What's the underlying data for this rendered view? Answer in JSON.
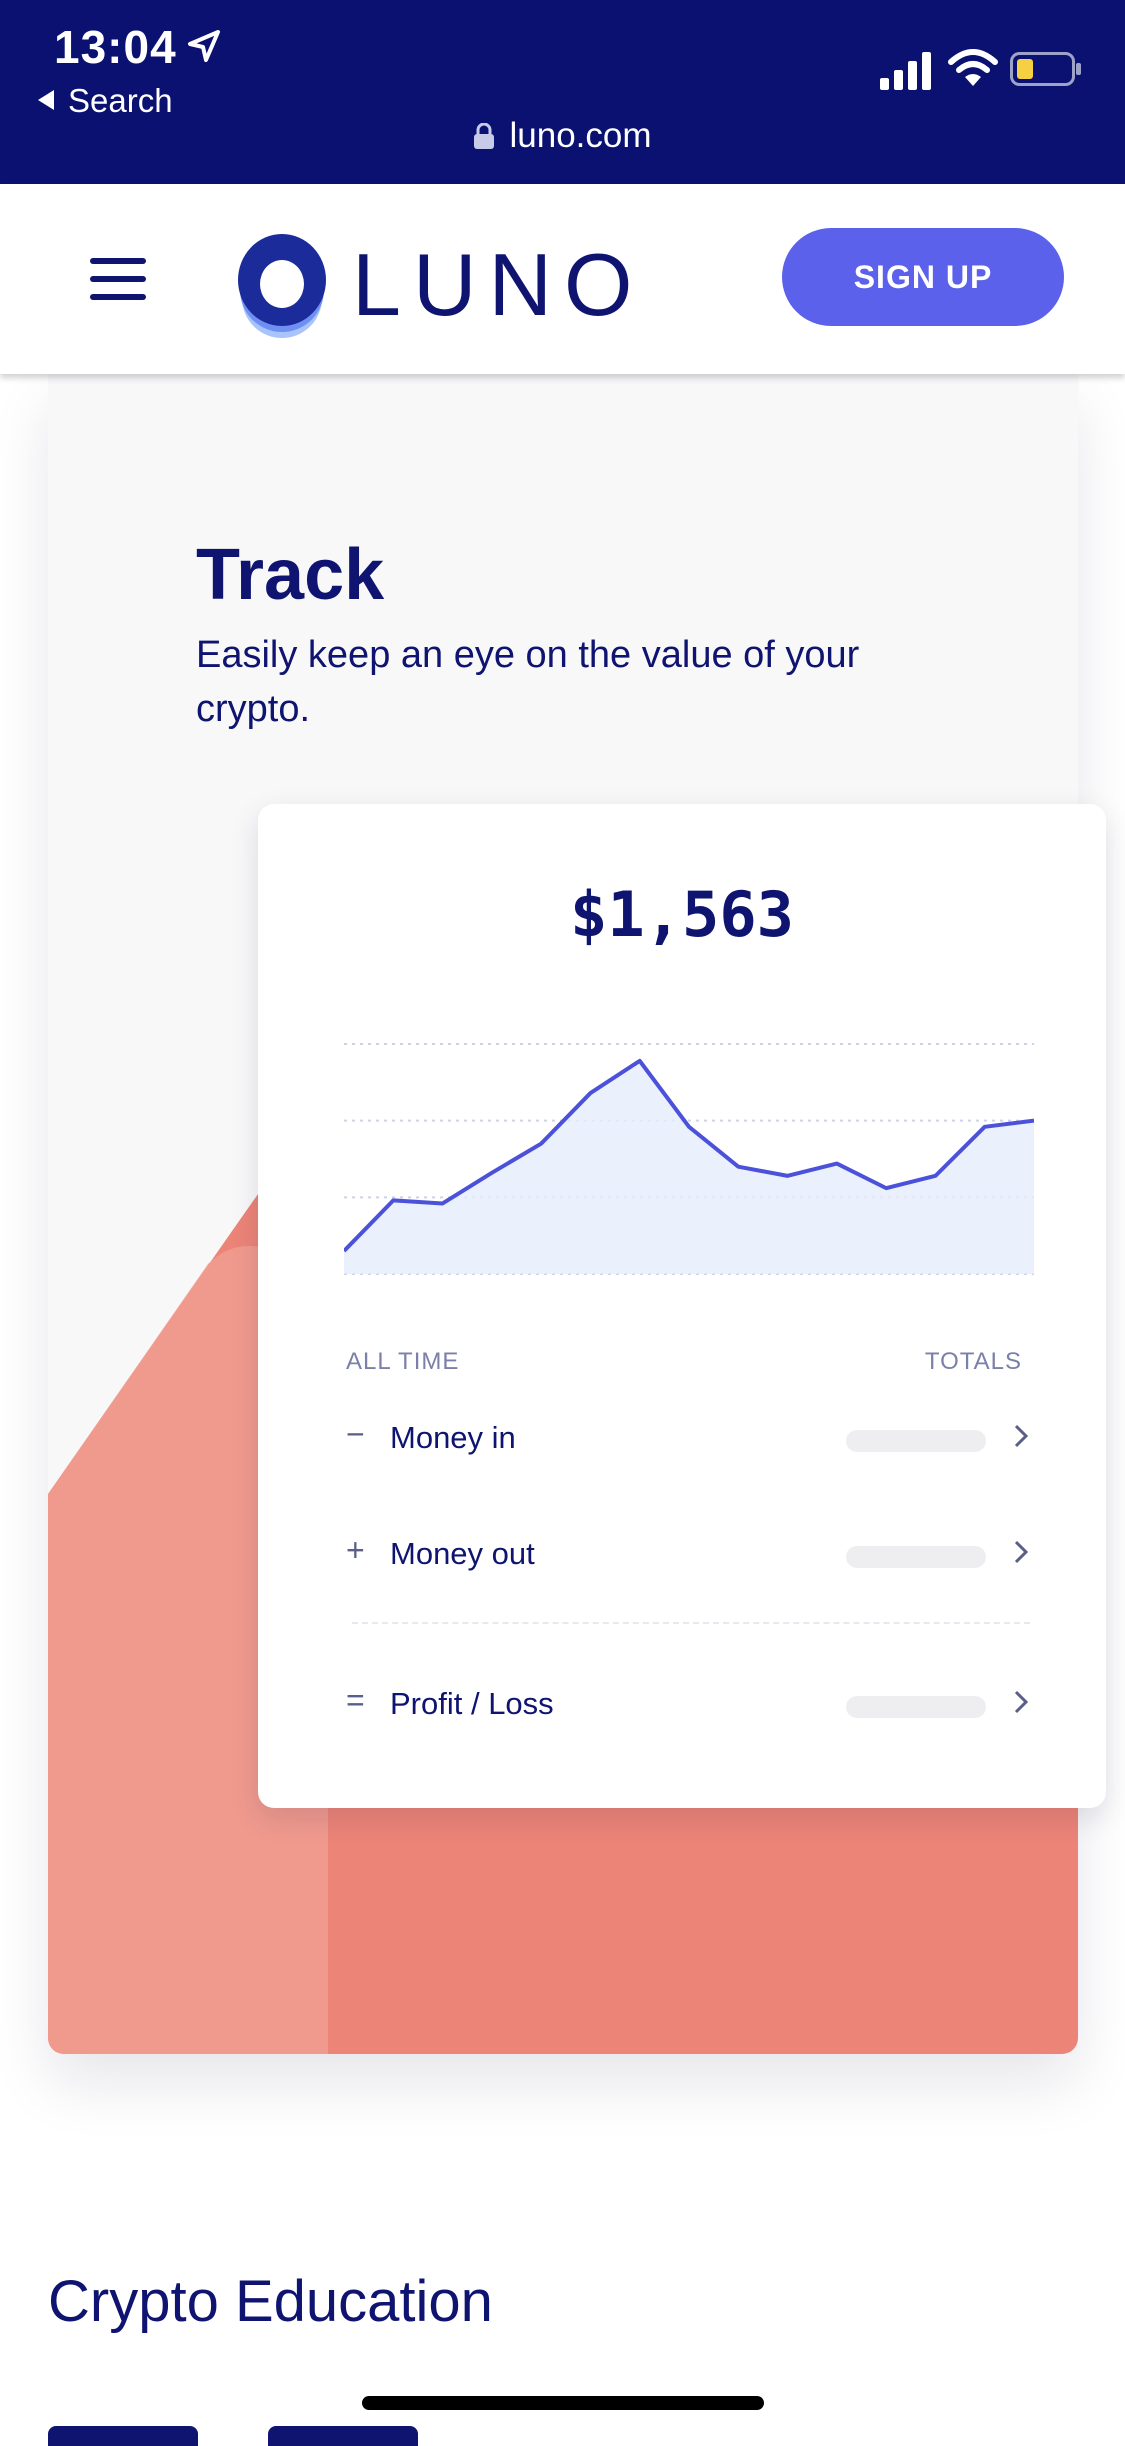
{
  "status_bar": {
    "time": "13:04",
    "back_label": "Search",
    "url": "luno.com"
  },
  "header": {
    "brand": "LUNO",
    "signup_label": "SIGN UP"
  },
  "feature": {
    "title": "Track",
    "description": "Easily keep an eye on the value of your crypto."
  },
  "widget": {
    "amount": "$1,563",
    "left_header": "ALL TIME",
    "right_header": "TOTALS",
    "rows": [
      {
        "symbol": "−",
        "label": "Money in"
      },
      {
        "symbol": "+",
        "label": "Money out"
      },
      {
        "symbol": "=",
        "label": "Profit / Loss"
      }
    ]
  },
  "chart_data": {
    "type": "area",
    "x": [
      0,
      1,
      2,
      3,
      4,
      5,
      6,
      7,
      8,
      9,
      10,
      11,
      12,
      13,
      14
    ],
    "values": [
      15,
      48,
      46,
      66,
      85,
      118,
      139,
      96,
      70,
      64,
      72,
      56,
      64,
      96,
      100
    ],
    "ylim": [
      0,
      150
    ],
    "grid": true,
    "colors": {
      "line": "#4b52d9",
      "fill": "#e6ecfd"
    }
  },
  "sections": {
    "education_title": "Crypto Education"
  },
  "colors": {
    "brand_navy": "#0a1170",
    "accent": "#5b61ea",
    "coral": "#ec8478"
  }
}
